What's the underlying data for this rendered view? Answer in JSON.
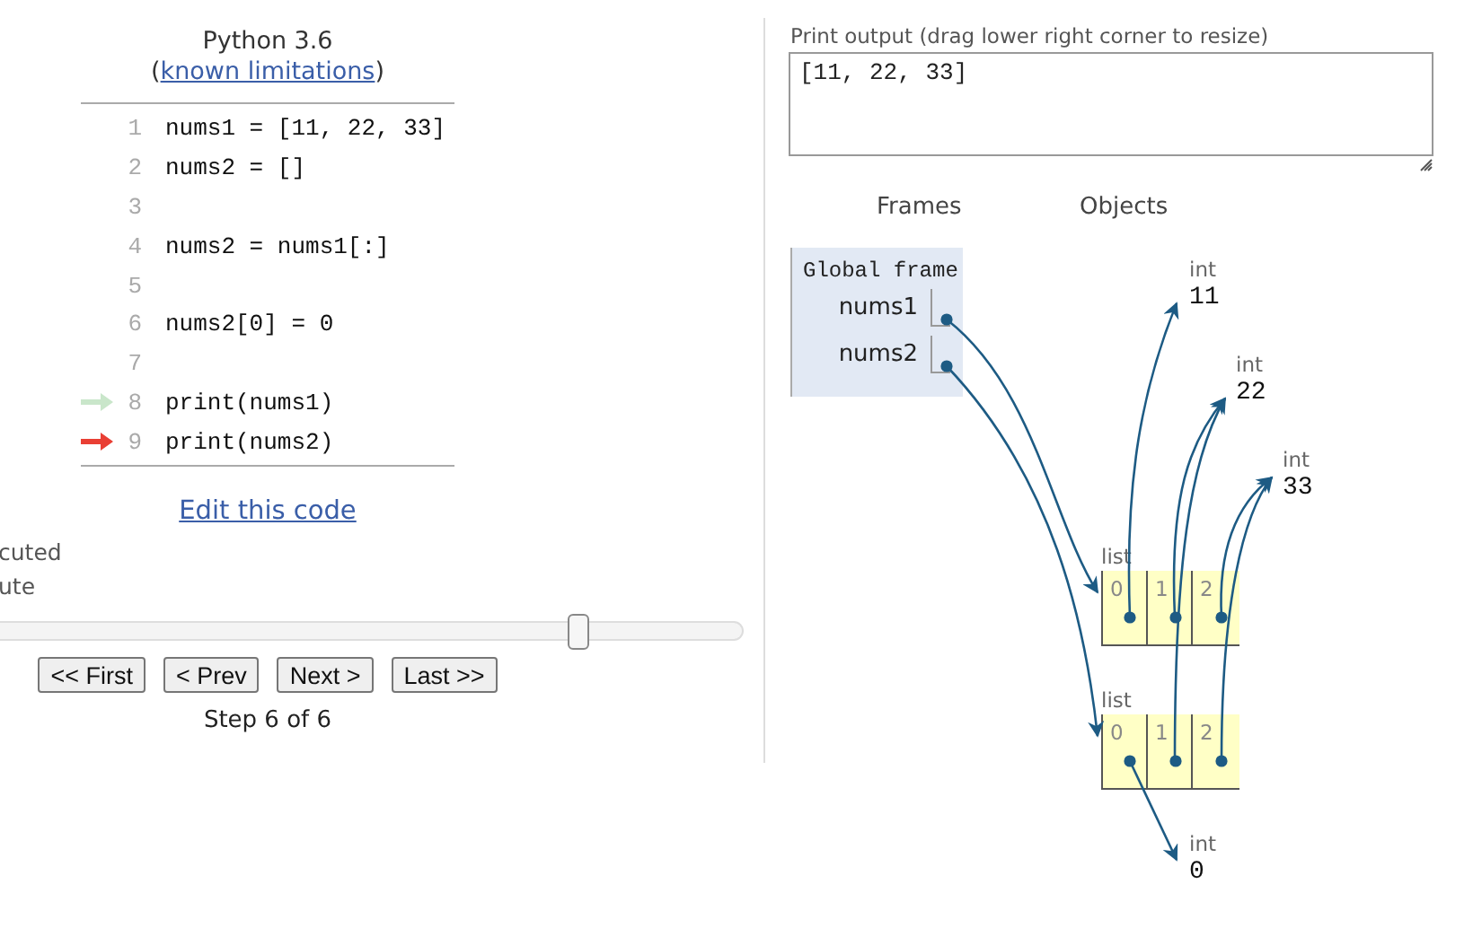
{
  "header": {
    "title": "Python 3.6",
    "link_open": "(",
    "link": "known limitations",
    "link_close": ")"
  },
  "code": [
    {
      "number": "1",
      "text": "nums1 = [11, 22, 33]",
      "kind": "plain"
    },
    {
      "number": "2",
      "text": "nums2 = []",
      "kind": "plain"
    },
    {
      "number": "3",
      "kind": "plain"
    },
    {
      "number": "4",
      "text": "nums2 = nums1[:]",
      "kind": "plain"
    },
    {
      "number": "5",
      "kind": "plain"
    },
    {
      "number": "6",
      "text": "nums2[0] = 0",
      "kind": "plain"
    },
    {
      "number": "7",
      "kind": "plain"
    },
    {
      "number": "8",
      "text": "print(nums1)",
      "kind": "executed"
    },
    {
      "number": "9",
      "text": "print(nums2)",
      "kind": "next"
    }
  ],
  "edit_link": "Edit this code",
  "legend": [
    "cuted",
    "ute"
  ],
  "slider": {
    "level": 0.78
  },
  "buttons": [
    "<< First",
    "< Prev",
    "Next >",
    "Last >>"
  ],
  "step": "Step 6 of 6",
  "output": {
    "label": "Print output (drag lower right corner to resize)",
    "value": "[11, 22, 33]"
  },
  "headings": {
    "frames": "Frames",
    "objects": "Objects"
  },
  "frame": {
    "title": "Global frame",
    "vars": [
      {
        "name": "nums1"
      },
      {
        "name": "nums2"
      }
    ]
  },
  "objects": [
    {
      "kind": "int",
      "label": "int",
      "value": "11"
    },
    {
      "kind": "int",
      "label": "int",
      "value": "22"
    },
    {
      "kind": "int",
      "label": "int",
      "value": "33"
    },
    {
      "kind": "list",
      "label": "list",
      "items": [
        "0",
        "1",
        "2"
      ]
    },
    {
      "kind": "list",
      "label": "list",
      "items": [
        "0",
        "1",
        "2"
      ]
    },
    {
      "kind": "int",
      "label": "int",
      "value": "0"
    }
  ]
}
